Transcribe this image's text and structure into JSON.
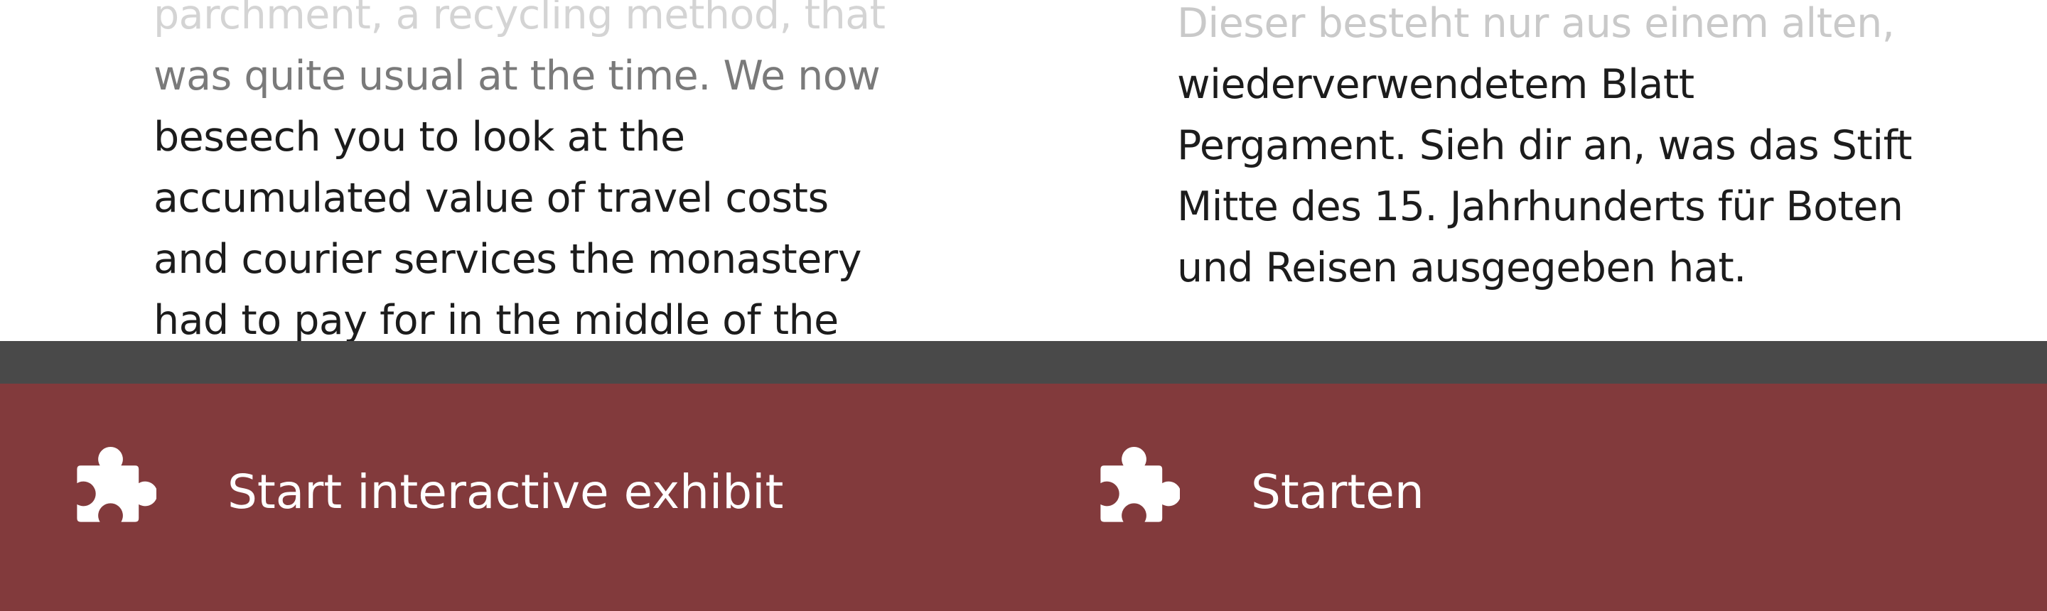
{
  "english_text": {
    "lines": [
      "parchment, a recycling method, that",
      "was quite usual at the time. We now",
      "beseech you to look at the",
      "accumulated value of travel costs",
      "and courier services the monastery",
      "had to pay for in the middle of the"
    ]
  },
  "german_text": {
    "lines": [
      "Dieser besteht nur aus einem alten,",
      "wiederverwendetem Blatt",
      "Pergament. Sieh dir an, was das Stift",
      "Mitte des 15. Jahrhunderts für Boten",
      "und Reisen ausgegeben hat."
    ]
  },
  "buttons": {
    "english": {
      "label": "Start interactive exhibit",
      "icon": "puzzle-piece-icon"
    },
    "german": {
      "label": "Starten",
      "icon": "puzzle-piece-icon"
    }
  },
  "colors": {
    "bottom_bar": "#823a3c",
    "divider_band": "#494949",
    "text": "#1c1c1c",
    "button_text": "#ffffff"
  }
}
